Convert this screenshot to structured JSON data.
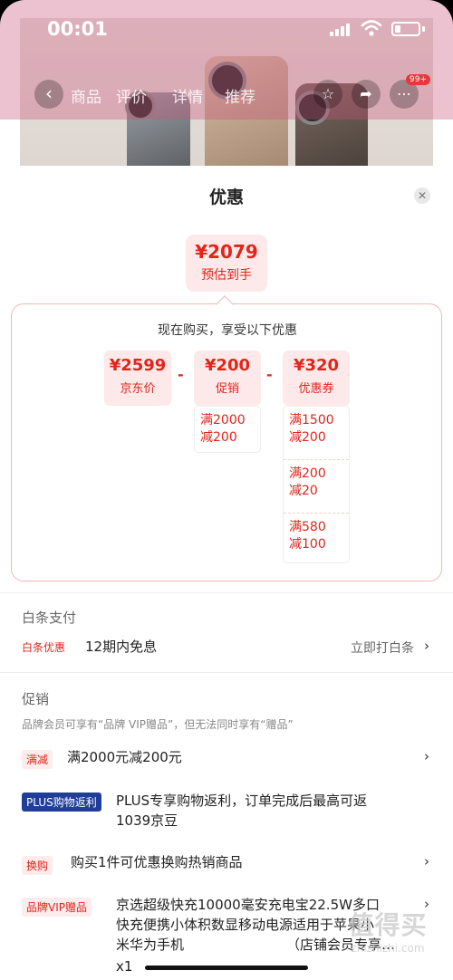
{
  "status": {
    "time": "00:01"
  },
  "nav": {
    "tabs": [
      "商品",
      "评价",
      "详情",
      "推荐"
    ],
    "cart_badge": "99+"
  },
  "sheet": {
    "title": "优惠",
    "total": {
      "amount": "¥2079",
      "label": "预估到手"
    },
    "calc": {
      "title": "现在购买，享受以下优惠",
      "jd_price": {
        "amount": "¥2599",
        "label": "京东价"
      },
      "promo": {
        "amount": "¥200",
        "label": "促销",
        "rules": [
          {
            "l1": "满2000",
            "l2": "减200"
          }
        ]
      },
      "coupon": {
        "amount": "¥320",
        "label": "优惠券",
        "rules": [
          {
            "l1": "满1500",
            "l2": "减200"
          },
          {
            "l1": "满200",
            "l2": "减20"
          },
          {
            "l1": "满580",
            "l2": "减100"
          }
        ]
      },
      "minus": "-"
    },
    "baitiao": {
      "section_title": "白条支付",
      "tag": "白条优惠",
      "text": "12期内免息",
      "action": "立即打白条"
    },
    "promotions": {
      "section_title": "促销",
      "note": "品牌会员可享有“品牌 VIP赠品”，但无法同时享有“赠品”",
      "items": [
        {
          "tag": "满减",
          "text": "满2000元减200元"
        },
        {
          "tag": "PLUS购物返利",
          "text": "PLUS专享购物返利，订单完成后最高可返",
          "text2": "1039京豆"
        },
        {
          "tag": "换购",
          "text": "购买1件可优惠换购热销商品"
        },
        {
          "tag": "品牌VIP赠品",
          "text": "京选超级快充10000毫安充电宝22.5W多口",
          "text2": "快充便携小体积数显移动电源适用于苹果小",
          "text3": "米华为手机",
          "text4": "（店铺会员专享…",
          "qty": "x1"
        }
      ]
    }
  },
  "watermark": {
    "big": "值得买",
    "small": "zhizhizhi.com"
  }
}
